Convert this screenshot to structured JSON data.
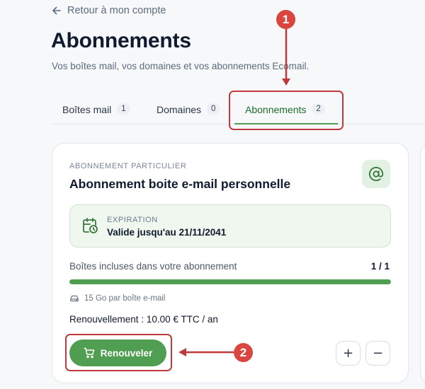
{
  "header": {
    "back_label": "Retour à mon compte",
    "title": "Abonnements",
    "subtitle": "Vos boîtes mail, vos domaines et vos abonnements Ecomail."
  },
  "tabs": [
    {
      "label": "Boîtes mail",
      "count": "1",
      "active": false
    },
    {
      "label": "Domaines",
      "count": "0",
      "active": false
    },
    {
      "label": "Abonnements",
      "count": "2",
      "active": true
    }
  ],
  "card": {
    "eyebrow": "ABONNEMENT PARTICULIER",
    "title": "Abonnement boite e-mail personnelle",
    "badge_icon": "at-sign-icon",
    "expiry": {
      "label": "EXPIRATION",
      "value": "Valide jusqu'au 21/11/2041",
      "icon": "calendar-clock-icon"
    },
    "included": {
      "label": "Boîtes incluses dans votre abonnement",
      "count": "1 / 1",
      "progress": 1.0
    },
    "storage": "15 Go par boîte e-mail",
    "renewal": "Renouvellement : 10.00 € TTC / an",
    "renew_button": "Renouveler",
    "plus": "+",
    "minus": "−"
  },
  "annotations": {
    "one": "1",
    "two": "2"
  },
  "colors": {
    "accent": "#4f9e52",
    "annotation": "#c0393b"
  }
}
